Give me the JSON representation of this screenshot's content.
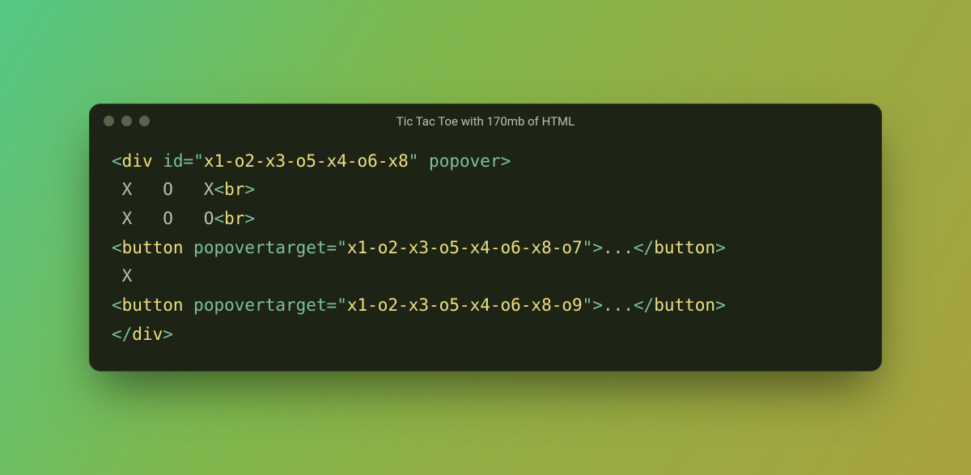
{
  "window": {
    "title": "Tic Tac Toe with 170mb of HTML"
  },
  "code": {
    "l1": {
      "open": "<",
      "tag": "div",
      "sp1": " ",
      "attr_id": "id",
      "eq": "=",
      "q1": "\"",
      "id_val": "x1-o2-x3-o5-x4-o6-x8",
      "q2": "\"",
      "sp2": " ",
      "attr_popover": "popover",
      "close": ">"
    },
    "l2": {
      "text": " X   O   X",
      "lt": "<",
      "tag": "br",
      "gt": ">"
    },
    "l3": {
      "text": " X   O   O",
      "lt": "<",
      "tag": "br",
      "gt": ">"
    },
    "l4": {
      "open": "<",
      "tag": "button",
      "sp": " ",
      "attr": "popovertarget",
      "eq": "=",
      "q1": "\"",
      "val": "x1-o2-x3-o5-x4-o6-x8-o7",
      "q2": "\"",
      "gt": ">",
      "content": "...",
      "clt": "</",
      "ctag": "button",
      "cgt": ">"
    },
    "l5": {
      "text": " X"
    },
    "l6": {
      "open": "<",
      "tag": "button",
      "sp": " ",
      "attr": "popovertarget",
      "eq": "=",
      "q1": "\"",
      "val": "x1-o2-x3-o5-x4-o6-x8-o9",
      "q2": "\"",
      "gt": ">",
      "content": "...",
      "clt": "</",
      "ctag": "button",
      "cgt": ">"
    },
    "l7": {
      "clt": "</",
      "tag": "div",
      "gt": ">"
    }
  }
}
